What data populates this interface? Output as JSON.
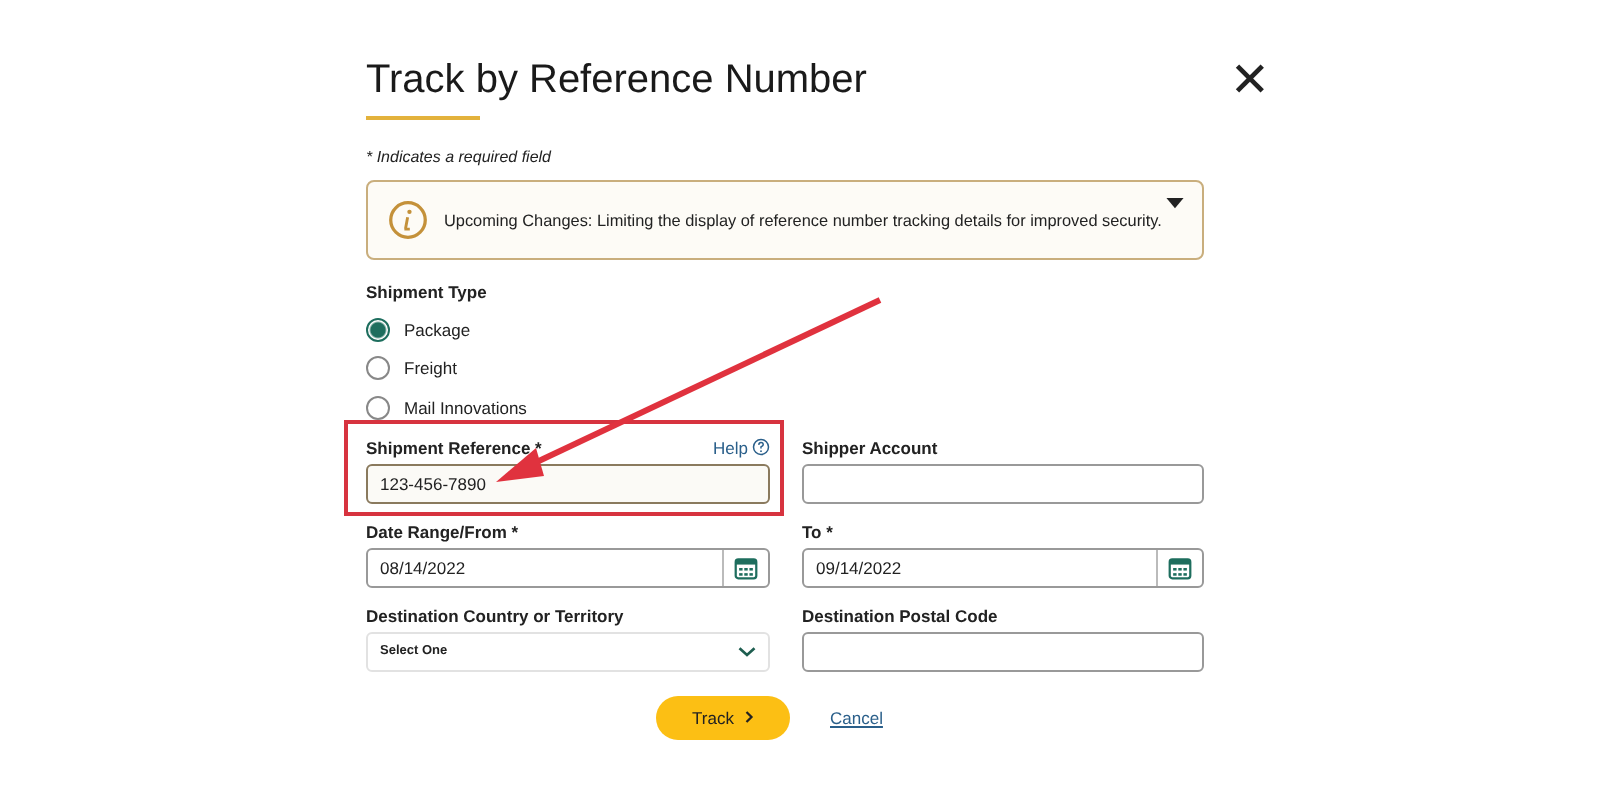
{
  "title": "Track by Reference Number",
  "close": "✕",
  "required_note": "* Indicates a required field",
  "notice": {
    "text": "Upcoming Changes: Limiting the display of reference number tracking details for improved security.",
    "expanded": false
  },
  "shipment_type": {
    "label": "Shipment Type",
    "options": [
      {
        "label": "Package",
        "selected": true
      },
      {
        "label": "Freight",
        "selected": false
      },
      {
        "label": "Mail Innovations",
        "selected": false
      }
    ]
  },
  "fields": [
    {
      "kind": "text",
      "label": "Shipment Reference *",
      "help": "Help",
      "value": "123-456-7890",
      "highlighted": true
    },
    {
      "kind": "text",
      "label": "Shipper Account"
    },
    {
      "kind": "date",
      "label": "Date Range/From *",
      "value": "08/14/2022"
    },
    {
      "kind": "date",
      "label": "To *",
      "value": "09/14/2022"
    },
    {
      "kind": "select",
      "label": "Destination Country or Territory",
      "value": "Select One"
    },
    {
      "kind": "text",
      "label": "Destination Postal Code"
    }
  ],
  "buttons": {
    "track": "Track",
    "cancel": "Cancel"
  }
}
